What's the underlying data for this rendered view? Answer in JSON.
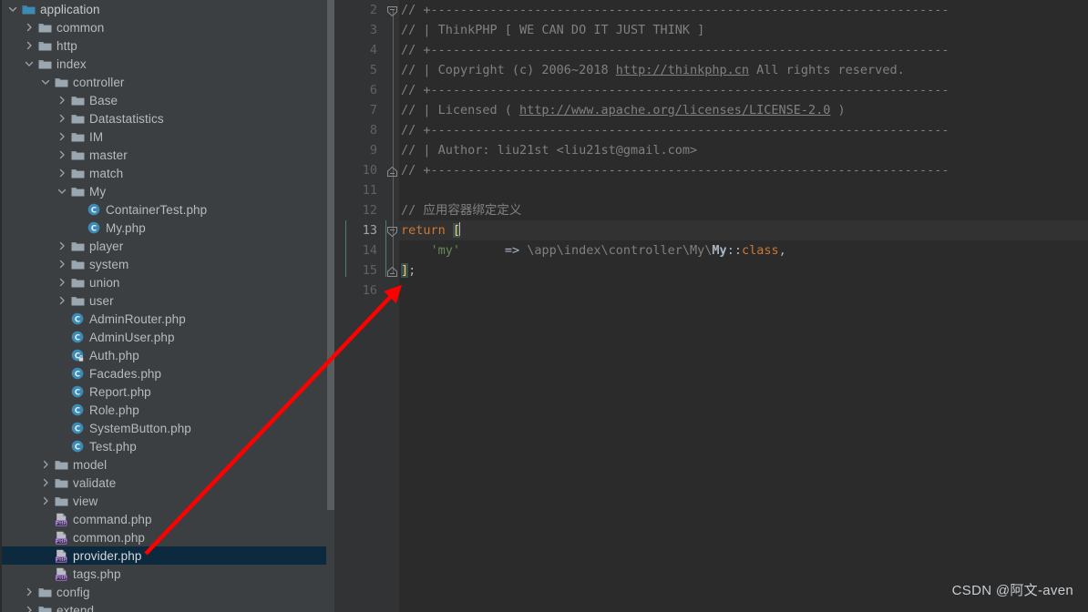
{
  "tree": {
    "items": [
      {
        "label": "application",
        "depth": 1,
        "twisty": "down",
        "icon": "module-folder-icon",
        "selected": false
      },
      {
        "label": "common",
        "depth": 2,
        "twisty": "right",
        "icon": "folder-icon",
        "selected": false
      },
      {
        "label": "http",
        "depth": 2,
        "twisty": "right",
        "icon": "folder-icon",
        "selected": false
      },
      {
        "label": "index",
        "depth": 2,
        "twisty": "down",
        "icon": "folder-icon",
        "selected": false
      },
      {
        "label": "controller",
        "depth": 3,
        "twisty": "down",
        "icon": "folder-icon",
        "selected": false
      },
      {
        "label": "Base",
        "depth": 4,
        "twisty": "right",
        "icon": "folder-icon",
        "selected": false
      },
      {
        "label": "Datastatistics",
        "depth": 4,
        "twisty": "right",
        "icon": "folder-icon",
        "selected": false
      },
      {
        "label": "IM",
        "depth": 4,
        "twisty": "right",
        "icon": "folder-icon",
        "selected": false
      },
      {
        "label": "master",
        "depth": 4,
        "twisty": "right",
        "icon": "folder-icon",
        "selected": false
      },
      {
        "label": "match",
        "depth": 4,
        "twisty": "right",
        "icon": "folder-icon",
        "selected": false
      },
      {
        "label": "My",
        "depth": 4,
        "twisty": "down",
        "icon": "folder-icon",
        "selected": false
      },
      {
        "label": "ContainerTest.php",
        "depth": 5,
        "twisty": "none",
        "icon": "php-class-icon",
        "selected": false
      },
      {
        "label": "My.php",
        "depth": 5,
        "twisty": "none",
        "icon": "php-class-icon",
        "selected": false
      },
      {
        "label": "player",
        "depth": 4,
        "twisty": "right",
        "icon": "folder-icon",
        "selected": false
      },
      {
        "label": "system",
        "depth": 4,
        "twisty": "right",
        "icon": "folder-icon",
        "selected": false
      },
      {
        "label": "union",
        "depth": 4,
        "twisty": "right",
        "icon": "folder-icon",
        "selected": false
      },
      {
        "label": "user",
        "depth": 4,
        "twisty": "right",
        "icon": "folder-icon",
        "selected": false
      },
      {
        "label": "AdminRouter.php",
        "depth": 4,
        "twisty": "none",
        "icon": "php-class-icon",
        "selected": false
      },
      {
        "label": "AdminUser.php",
        "depth": 4,
        "twisty": "none",
        "icon": "php-class-icon",
        "selected": false
      },
      {
        "label": "Auth.php",
        "depth": 4,
        "twisty": "none",
        "icon": "php-class-locked-icon",
        "selected": false
      },
      {
        "label": "Facades.php",
        "depth": 4,
        "twisty": "none",
        "icon": "php-class-icon",
        "selected": false
      },
      {
        "label": "Report.php",
        "depth": 4,
        "twisty": "none",
        "icon": "php-class-icon",
        "selected": false
      },
      {
        "label": "Role.php",
        "depth": 4,
        "twisty": "none",
        "icon": "php-class-icon",
        "selected": false
      },
      {
        "label": "SystemButton.php",
        "depth": 4,
        "twisty": "none",
        "icon": "php-class-icon",
        "selected": false
      },
      {
        "label": "Test.php",
        "depth": 4,
        "twisty": "none",
        "icon": "php-class-icon",
        "selected": false
      },
      {
        "label": "model",
        "depth": 3,
        "twisty": "right",
        "icon": "folder-icon",
        "selected": false
      },
      {
        "label": "validate",
        "depth": 3,
        "twisty": "right",
        "icon": "folder-icon",
        "selected": false
      },
      {
        "label": "view",
        "depth": 3,
        "twisty": "right",
        "icon": "folder-icon",
        "selected": false
      },
      {
        "label": "command.php",
        "depth": 3,
        "twisty": "none",
        "icon": "php-file-icon",
        "selected": false
      },
      {
        "label": "common.php",
        "depth": 3,
        "twisty": "none",
        "icon": "php-file-icon",
        "selected": false
      },
      {
        "label": "provider.php",
        "depth": 3,
        "twisty": "none",
        "icon": "php-file-icon",
        "selected": true
      },
      {
        "label": "tags.php",
        "depth": 3,
        "twisty": "none",
        "icon": "php-file-icon",
        "selected": false
      },
      {
        "label": "config",
        "depth": 2,
        "twisty": "right",
        "icon": "folder-icon",
        "selected": false
      },
      {
        "label": "extend",
        "depth": 2,
        "twisty": "right",
        "icon": "folder-icon",
        "selected": false
      }
    ]
  },
  "editor": {
    "lines": [
      {
        "num": "2",
        "current": false
      },
      {
        "num": "3",
        "current": false
      },
      {
        "num": "4",
        "current": false
      },
      {
        "num": "5",
        "current": false
      },
      {
        "num": "6",
        "current": false
      },
      {
        "num": "7",
        "current": false
      },
      {
        "num": "8",
        "current": false
      },
      {
        "num": "9",
        "current": false
      },
      {
        "num": "10",
        "current": false
      },
      {
        "num": "11",
        "current": false
      },
      {
        "num": "12",
        "current": false
      },
      {
        "num": "13",
        "current": true
      },
      {
        "num": "14",
        "current": false
      },
      {
        "num": "15",
        "current": false
      },
      {
        "num": "16",
        "current": false
      }
    ],
    "code": {
      "l2_rule": "// +----------------------------------------------------------------------",
      "l3_title": "// | ThinkPHP [ WE CAN DO IT JUST THINK ]",
      "l4_rule": "// +----------------------------------------------------------------------",
      "l5_prefix": "// | Copyright (c) 2006~2018 ",
      "l5_link": "http://thinkphp.cn",
      "l5_suffix": " All rights reserved.",
      "l6_rule": "// +----------------------------------------------------------------------",
      "l7_prefix": "// | Licensed ( ",
      "l7_link": "http://www.apache.org/licenses/LICENSE-2.0",
      "l7_suffix": " )",
      "l8_rule": "// +----------------------------------------------------------------------",
      "l9_author": "// | Author: liu21st <liu21st@gmail.com>",
      "l10_rule": "// +----------------------------------------------------------------------",
      "l11_blank": "",
      "l12_comment": "// 应用容器绑定定义",
      "l13_kw": "return",
      "l13_brk": "[",
      "l14_key": "'my'",
      "l14_arrow": "=>",
      "l14_path": "\\app\\index\\controller\\My\\",
      "l14_cls": "My",
      "l14_sep": "::",
      "l14_class": "class",
      "l14_comma": ",",
      "l15_brk": "]",
      "l15_semi": ";",
      "l16_blank": ""
    }
  },
  "watermark": {
    "text": "CSDN @阿文-aven"
  },
  "colors": {
    "tree_bg": "#3c3f41",
    "editor_bg": "#2b2b2b",
    "gutter_bg": "#313335",
    "selection_bg": "#0d293e",
    "keyword": "#cc7832",
    "string": "#6a8759",
    "bracket": "#ffc66d",
    "comment": "#808080",
    "arrow": "#fe0000"
  }
}
